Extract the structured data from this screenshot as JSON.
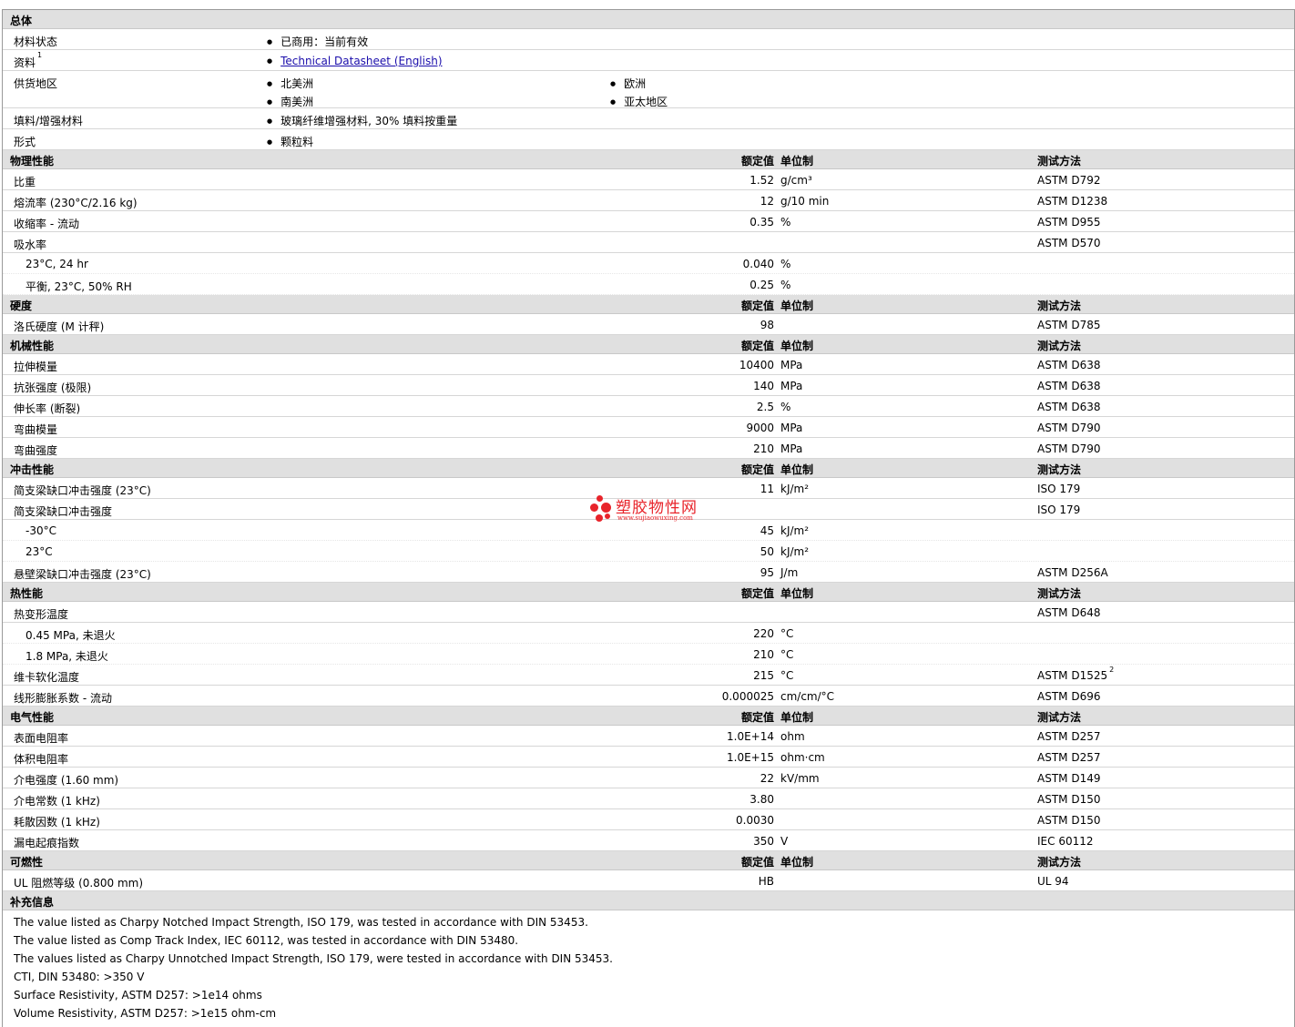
{
  "general": {
    "title": "总体",
    "rows": [
      {
        "label": "材料状态",
        "values": [
          "已商用：当前有效"
        ]
      },
      {
        "label": "资料",
        "sup": "1",
        "link": "Technical Datasheet (English)"
      },
      {
        "label": "供货地区",
        "values": [
          "北美洲",
          "欧洲",
          "南美洲",
          "亚太地区"
        ]
      },
      {
        "label": "填料/增强材料",
        "values": [
          "玻璃纤维增强材料, 30% 填料按重量"
        ]
      },
      {
        "label": "形式",
        "values": [
          "颗粒料"
        ]
      }
    ]
  },
  "col_headers": {
    "nominal": "额定值",
    "unit": "单位制",
    "method": "测试方法"
  },
  "sections": [
    {
      "title": "物理性能",
      "rows": [
        {
          "label": "比重",
          "value": "1.52",
          "unit": "g/cm³",
          "method": "ASTM D792"
        },
        {
          "label": "熔流率 (230°C/2.16 kg)",
          "value": "12",
          "unit": "g/10 min",
          "method": "ASTM D1238"
        },
        {
          "label": "收缩率 - 流动",
          "value": "0.35",
          "unit": "%",
          "method": "ASTM D955"
        },
        {
          "label": "吸水率",
          "value": "",
          "unit": "",
          "method": "ASTM D570"
        },
        {
          "label": "23°C, 24 hr",
          "sub": true,
          "value": "0.040",
          "unit": "%",
          "method": ""
        },
        {
          "label": "平衡, 23°C, 50% RH",
          "sub": true,
          "value": "0.25",
          "unit": "%",
          "method": ""
        }
      ]
    },
    {
      "title": "硬度",
      "rows": [
        {
          "label": "洛氏硬度 (M 计秤)",
          "value": "98",
          "unit": "",
          "method": "ASTM D785"
        }
      ]
    },
    {
      "title": "机械性能",
      "rows": [
        {
          "label": "拉伸模量",
          "value": "10400",
          "unit": "MPa",
          "method": "ASTM D638"
        },
        {
          "label": "抗张强度 (极限)",
          "value": "140",
          "unit": "MPa",
          "method": "ASTM D638"
        },
        {
          "label": "伸长率 (断裂)",
          "value": "2.5",
          "unit": "%",
          "method": "ASTM D638"
        },
        {
          "label": "弯曲模量",
          "value": "9000",
          "unit": "MPa",
          "method": "ASTM D790"
        },
        {
          "label": "弯曲强度",
          "value": "210",
          "unit": "MPa",
          "method": "ASTM D790"
        }
      ]
    },
    {
      "title": "冲击性能",
      "rows": [
        {
          "label": "简支梁缺口冲击强度 (23°C)",
          "value": "11",
          "unit": "kJ/m²",
          "method": "ISO 179"
        },
        {
          "label": "简支梁缺口冲击强度",
          "value": "",
          "unit": "",
          "method": "ISO 179"
        },
        {
          "label": "-30°C",
          "sub": true,
          "value": "45",
          "unit": "kJ/m²",
          "method": ""
        },
        {
          "label": "23°C",
          "sub": true,
          "value": "50",
          "unit": "kJ/m²",
          "method": ""
        },
        {
          "label": "悬壁梁缺口冲击强度 (23°C)",
          "value": "95",
          "unit": "J/m",
          "method": "ASTM D256A"
        }
      ]
    },
    {
      "title": "热性能",
      "rows": [
        {
          "label": "热变形温度",
          "value": "",
          "unit": "",
          "method": "ASTM D648"
        },
        {
          "label": "0.45 MPa, 未退火",
          "sub": true,
          "value": "220",
          "unit": "°C",
          "method": ""
        },
        {
          "label": "1.8 MPa, 未退火",
          "sub": true,
          "value": "210",
          "unit": "°C",
          "method": ""
        },
        {
          "label": "维卡软化温度",
          "value": "215",
          "unit": "°C",
          "method": "ASTM D1525",
          "method_sup": "2"
        },
        {
          "label": "线形膨胀系数 - 流动",
          "value": "0.000025",
          "unit": "cm/cm/°C",
          "method": "ASTM D696"
        }
      ]
    },
    {
      "title": "电气性能",
      "rows": [
        {
          "label": "表面电阻率",
          "value": "1.0E+14",
          "unit": "ohm",
          "method": "ASTM D257"
        },
        {
          "label": "体积电阻率",
          "value": "1.0E+15",
          "unit": "ohm·cm",
          "method": "ASTM D257"
        },
        {
          "label": "介电强度 (1.60 mm)",
          "value": "22",
          "unit": "kV/mm",
          "method": "ASTM D149"
        },
        {
          "label": "介电常数 (1 kHz)",
          "value": "3.80",
          "unit": "",
          "method": "ASTM D150"
        },
        {
          "label": "耗散因数 (1 kHz)",
          "value": "0.0030",
          "unit": "",
          "method": "ASTM D150"
        },
        {
          "label": "漏电起痕指数",
          "value": "350",
          "unit": "V",
          "method": "IEC 60112"
        }
      ]
    },
    {
      "title": "可燃性",
      "rows": [
        {
          "label": "UL 阻燃等级 (0.800 mm)",
          "value": "HB",
          "unit": "",
          "method": "UL 94"
        }
      ]
    }
  ],
  "notes": {
    "title": "补充信息",
    "lines": [
      "The value listed as Charpy Notched Impact Strength, ISO 179, was tested in accordance with DIN 53453.",
      "The value listed as Comp Track Index, IEC 60112, was tested in accordance with DIN 53480.",
      "The values listed as Charpy Unnotched Impact Strength, ISO 179, were tested in accordance with DIN 53453.",
      "CTI, DIN 53480: >350 V",
      "Surface Resistivity, ASTM D257: >1e14 ohms",
      "Volume Resistivity, ASTM D257: >1e15 ohm-cm"
    ]
  },
  "watermark": {
    "title": "塑胶物性网",
    "url": "www.sujiaowuxing.com",
    "color": "#e8242b"
  }
}
